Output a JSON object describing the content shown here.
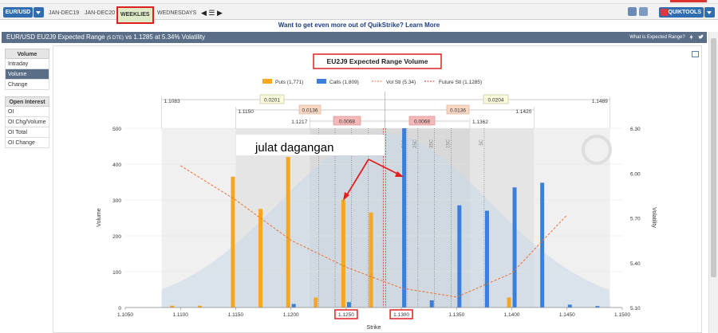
{
  "toolbar": {
    "pair_label": "EUR/USD",
    "tabs": [
      "JAN-DEC19",
      "JAN-DEC20",
      "WEEKLIES",
      "WEDNESDAYS"
    ],
    "tab_icons": "◀ ☰ ▶",
    "quiktools_label": "QUIKTOOLS"
  },
  "promo": {
    "text": "Want to get even more out of QuikStrike? Learn More"
  },
  "titlebar": {
    "title": "EUR/USD EU2J9 Expected Range",
    "dte": "(5 DTE)",
    "subtitle": "vs 1.1285 at 5.34% Volatility",
    "help": "What is Expected Range?"
  },
  "sidebar": {
    "group1": "Volume",
    "items1": [
      "Intraday",
      "Volume",
      "Change"
    ],
    "group2": "Open Interest",
    "items2": [
      "OI",
      "OI Chg/Volume",
      "OI Total",
      "OI Change"
    ]
  },
  "colors": {
    "puts": "#f5a623",
    "calls": "#3a7fd9",
    "vol": "#f07030",
    "future": "#d03030",
    "accent": "#e02020"
  },
  "chart_data": {
    "type": "bar",
    "title": "EU2J9 Expected Range Volume",
    "xlabel": "Strike",
    "ylabel": "Volume",
    "y2label": "Volatility",
    "xlim": [
      1.105,
      1.15
    ],
    "ylim": [
      0,
      500
    ],
    "y2lim": [
      5.1,
      6.3
    ],
    "x_ticks": [
      "1.1050",
      "1.1100",
      "1.1150",
      "1.1200",
      "1.1250",
      "1.1300",
      "1.1350",
      "1.1400",
      "1.1450",
      "1.1500"
    ],
    "y_ticks": [
      "0",
      "100",
      "200",
      "300",
      "400",
      "500"
    ],
    "y2_ticks": [
      "5.10",
      "5.40",
      "5.70",
      "6.00",
      "6.30"
    ],
    "highlight_ticks": [
      "1.1250",
      "1.1300"
    ],
    "legend": [
      "Puts (1,771)",
      "Calls (1,809)",
      "Vol Stl (5.34)",
      "Future Stl (1.1285)"
    ],
    "series": [
      {
        "name": "Puts",
        "x": [
          1.1095,
          1.112,
          1.115,
          1.1175,
          1.12,
          1.1225,
          1.125,
          1.1275,
          1.14
        ],
        "values": [
          5,
          5,
          365,
          275,
          420,
          28,
          300,
          265,
          28
        ]
      },
      {
        "name": "Calls",
        "x": [
          1.12,
          1.125,
          1.13,
          1.1325,
          1.135,
          1.1375,
          1.14,
          1.1425,
          1.145,
          1.1475
        ],
        "values": [
          10,
          15,
          500,
          20,
          285,
          270,
          335,
          348,
          8,
          4
        ]
      },
      {
        "name": "Vol Stl",
        "x": [
          1.11,
          1.115,
          1.12,
          1.125,
          1.13,
          1.135,
          1.14,
          1.145
        ],
        "values": [
          6.05,
          5.82,
          5.55,
          5.37,
          5.23,
          5.17,
          5.33,
          5.72
        ]
      }
    ],
    "future_settle": 1.1285,
    "ranges": [
      {
        "label": "0.0201",
        "low": "1.1083",
        "high": "1.1489",
        "side": "outer"
      },
      {
        "label": "0.0204",
        "low": "",
        "high": "",
        "side": "outer"
      },
      {
        "label": "0.0136",
        "low": "1.1150",
        "high": "1.1420",
        "side": "middle"
      },
      {
        "label": "0.0136",
        "low": "",
        "high": "",
        "side": "middle"
      },
      {
        "label": "0.0068",
        "low": "1.1217",
        "high": "1.1362",
        "side": "inner"
      },
      {
        "label": "0.0068",
        "low": "",
        "high": "",
        "side": "inner"
      }
    ],
    "line_labels": [
      "5P",
      "5P",
      "5P",
      "5P",
      "50C",
      "25C",
      "35C",
      "15C",
      "5C"
    ],
    "annotation": "julat dagangan"
  }
}
